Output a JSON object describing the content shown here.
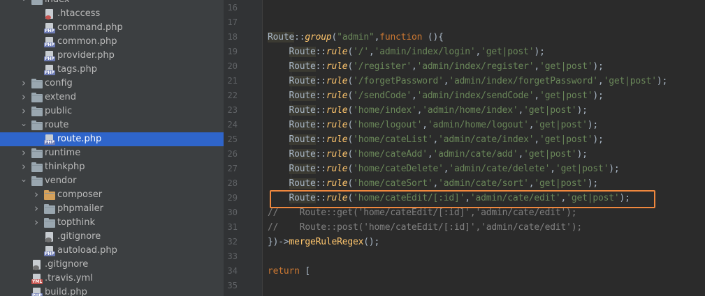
{
  "project_tree": {
    "rows": [
      {
        "label": "index",
        "kind": "folder",
        "depth": 2,
        "expanded": true,
        "badge": ""
      },
      {
        "label": ".htaccess",
        "kind": "file",
        "depth": 3,
        "badge": "ht",
        "icon": "htaccess-file-icon"
      },
      {
        "label": "command.php",
        "kind": "file",
        "depth": 3,
        "badge": "PHP",
        "icon": "php-file-icon"
      },
      {
        "label": "common.php",
        "kind": "file",
        "depth": 3,
        "badge": "PHP",
        "icon": "php-file-icon"
      },
      {
        "label": "provider.php",
        "kind": "file",
        "depth": 3,
        "badge": "PHP",
        "icon": "php-file-icon"
      },
      {
        "label": "tags.php",
        "kind": "file",
        "depth": 3,
        "badge": "PHP",
        "icon": "php-file-icon"
      },
      {
        "label": "config",
        "kind": "folder",
        "depth": 2,
        "expanded": false
      },
      {
        "label": "extend",
        "kind": "folder",
        "depth": 2,
        "expanded": false
      },
      {
        "label": "public",
        "kind": "folder",
        "depth": 2,
        "expanded": false
      },
      {
        "label": "route",
        "kind": "folder",
        "depth": 2,
        "expanded": true
      },
      {
        "label": "route.php",
        "kind": "file",
        "depth": 3,
        "badge": "PHP",
        "icon": "php-file-icon",
        "selected": true
      },
      {
        "label": "runtime",
        "kind": "folder",
        "depth": 2,
        "expanded": false
      },
      {
        "label": "thinkphp",
        "kind": "folder",
        "depth": 2,
        "expanded": false
      },
      {
        "label": "vendor",
        "kind": "folder",
        "depth": 2,
        "expanded": true
      },
      {
        "label": "composer",
        "kind": "folder",
        "depth": 3,
        "expanded": false,
        "highlight": true
      },
      {
        "label": "phpmailer",
        "kind": "folder",
        "depth": 3,
        "expanded": false
      },
      {
        "label": "topthink",
        "kind": "folder",
        "depth": 3,
        "expanded": false
      },
      {
        "label": ".gitignore",
        "kind": "file",
        "depth": 3,
        "badge": "git",
        "icon": "gitignore-file-icon"
      },
      {
        "label": "autoload.php",
        "kind": "file",
        "depth": 3,
        "badge": "PHP",
        "icon": "php-file-icon"
      },
      {
        "label": ".gitignore",
        "kind": "file",
        "depth": 2,
        "badge": "git",
        "icon": "gitignore-file-icon"
      },
      {
        "label": ".travis.yml",
        "kind": "file",
        "depth": 2,
        "badge": "YML",
        "icon": "yml-file-icon"
      },
      {
        "label": "build.php",
        "kind": "file",
        "depth": 2,
        "badge": "PHP",
        "icon": "php-file-icon"
      }
    ]
  },
  "editor": {
    "highlighted_line": 29,
    "lines": [
      {
        "num": "16",
        "tokens": []
      },
      {
        "num": "17",
        "tokens": []
      },
      {
        "num": "18",
        "tokens": [
          [
            "cls-hl",
            "Route"
          ],
          [
            "op",
            "::"
          ],
          [
            "fn",
            "group"
          ],
          [
            "pn",
            "("
          ],
          [
            "str",
            "\"admin\""
          ],
          [
            "pn",
            ","
          ],
          [
            "kw",
            "function"
          ],
          [
            "pn",
            " (){"
          ]
        ]
      },
      {
        "num": "19",
        "tokens": [
          [
            "pn",
            "    "
          ],
          [
            "cls-hl",
            "Route"
          ],
          [
            "op",
            "::"
          ],
          [
            "fn",
            "rule"
          ],
          [
            "pn",
            "("
          ],
          [
            "str",
            "'/'"
          ],
          [
            "pn",
            ","
          ],
          [
            "str",
            "'admin/index/login'"
          ],
          [
            "pn",
            ","
          ],
          [
            "str",
            "'get|post'"
          ],
          [
            "pn",
            ");"
          ]
        ]
      },
      {
        "num": "20",
        "tokens": [
          [
            "pn",
            "    "
          ],
          [
            "cls-hl",
            "Route"
          ],
          [
            "op",
            "::"
          ],
          [
            "fn",
            "rule"
          ],
          [
            "pn",
            "("
          ],
          [
            "str",
            "'/register'"
          ],
          [
            "pn",
            ","
          ],
          [
            "str",
            "'admin/index/register'"
          ],
          [
            "pn",
            ","
          ],
          [
            "str",
            "'get|post'"
          ],
          [
            "pn",
            ");"
          ]
        ]
      },
      {
        "num": "21",
        "tokens": [
          [
            "pn",
            "    "
          ],
          [
            "cls-hl",
            "Route"
          ],
          [
            "op",
            "::"
          ],
          [
            "fn",
            "rule"
          ],
          [
            "pn",
            "("
          ],
          [
            "str",
            "'/forgetPassword'"
          ],
          [
            "pn",
            ","
          ],
          [
            "str",
            "'admin/index/forgetPassword'"
          ],
          [
            "pn",
            ","
          ],
          [
            "str",
            "'get|post'"
          ],
          [
            "pn",
            ");"
          ]
        ]
      },
      {
        "num": "22",
        "tokens": [
          [
            "pn",
            "    "
          ],
          [
            "cls-hl",
            "Route"
          ],
          [
            "op",
            "::"
          ],
          [
            "fn",
            "rule"
          ],
          [
            "pn",
            "("
          ],
          [
            "str",
            "'/sendCode'"
          ],
          [
            "pn",
            ","
          ],
          [
            "str",
            "'admin/index/sendCode'"
          ],
          [
            "pn",
            ","
          ],
          [
            "str",
            "'get|post'"
          ],
          [
            "pn",
            ");"
          ]
        ]
      },
      {
        "num": "23",
        "tokens": [
          [
            "pn",
            "    "
          ],
          [
            "cls-hl",
            "Route"
          ],
          [
            "op",
            "::"
          ],
          [
            "fn",
            "rule"
          ],
          [
            "pn",
            "("
          ],
          [
            "str",
            "'home/index'"
          ],
          [
            "pn",
            ","
          ],
          [
            "str",
            "'admin/home/index'"
          ],
          [
            "pn",
            ","
          ],
          [
            "str",
            "'get|post'"
          ],
          [
            "pn",
            ");"
          ]
        ]
      },
      {
        "num": "24",
        "tokens": [
          [
            "pn",
            "    "
          ],
          [
            "cls-hl",
            "Route"
          ],
          [
            "op",
            "::"
          ],
          [
            "fn",
            "rule"
          ],
          [
            "pn",
            "("
          ],
          [
            "str",
            "'home/logout'"
          ],
          [
            "pn",
            ","
          ],
          [
            "str",
            "'admin/home/logout'"
          ],
          [
            "pn",
            ","
          ],
          [
            "str",
            "'get|post'"
          ],
          [
            "pn",
            ");"
          ]
        ]
      },
      {
        "num": "25",
        "tokens": [
          [
            "pn",
            "    "
          ],
          [
            "cls-hl",
            "Route"
          ],
          [
            "op",
            "::"
          ],
          [
            "fn",
            "rule"
          ],
          [
            "pn",
            "("
          ],
          [
            "str",
            "'home/cateList'"
          ],
          [
            "pn",
            ","
          ],
          [
            "str",
            "'admin/cate/index'"
          ],
          [
            "pn",
            ","
          ],
          [
            "str",
            "'get|post'"
          ],
          [
            "pn",
            ");"
          ]
        ]
      },
      {
        "num": "26",
        "tokens": [
          [
            "pn",
            "    "
          ],
          [
            "cls-hl",
            "Route"
          ],
          [
            "op",
            "::"
          ],
          [
            "fn",
            "rule"
          ],
          [
            "pn",
            "("
          ],
          [
            "str",
            "'home/cateAdd'"
          ],
          [
            "pn",
            ","
          ],
          [
            "str",
            "'admin/cate/add'"
          ],
          [
            "pn",
            ","
          ],
          [
            "str",
            "'get|post'"
          ],
          [
            "pn",
            ");"
          ]
        ]
      },
      {
        "num": "27",
        "tokens": [
          [
            "pn",
            "    "
          ],
          [
            "cls-hl",
            "Route"
          ],
          [
            "op",
            "::"
          ],
          [
            "fn",
            "rule"
          ],
          [
            "pn",
            "("
          ],
          [
            "str",
            "'home/cateDelete'"
          ],
          [
            "pn",
            ","
          ],
          [
            "str",
            "'admin/cate/delete'"
          ],
          [
            "pn",
            ","
          ],
          [
            "str",
            "'get|post'"
          ],
          [
            "pn",
            ");"
          ]
        ]
      },
      {
        "num": "28",
        "tokens": [
          [
            "pn",
            "    "
          ],
          [
            "cls-hl",
            "Route"
          ],
          [
            "op",
            "::"
          ],
          [
            "fn",
            "rule"
          ],
          [
            "pn",
            "("
          ],
          [
            "str",
            "'home/cateSort'"
          ],
          [
            "pn",
            ","
          ],
          [
            "str",
            "'admin/cate/sort'"
          ],
          [
            "pn",
            ","
          ],
          [
            "str",
            "'get|post'"
          ],
          [
            "pn",
            ");"
          ]
        ]
      },
      {
        "num": "29",
        "tokens": [
          [
            "pn",
            "    "
          ],
          [
            "cls-hl",
            "Route"
          ],
          [
            "op",
            "::"
          ],
          [
            "fn",
            "rule"
          ],
          [
            "pn",
            "("
          ],
          [
            "str",
            "'home/cateEdit/[:id]'"
          ],
          [
            "pn",
            ","
          ],
          [
            "str",
            "'admin/cate/edit'"
          ],
          [
            "pn",
            ","
          ],
          [
            "str",
            "'get|post'"
          ],
          [
            "pn",
            ");"
          ]
        ]
      },
      {
        "num": "30",
        "tokens": [
          [
            "cm",
            "//    Route::get('home/cateEdit/[:id]','admin/cate/edit');"
          ]
        ]
      },
      {
        "num": "31",
        "tokens": [
          [
            "cm",
            "//    Route::post('home/cateEdit/[:id]','admin/cate/edit');"
          ]
        ]
      },
      {
        "num": "32",
        "tokens": [
          [
            "pn",
            "})->"
          ],
          [
            "fn2",
            "mergeRuleRegex"
          ],
          [
            "pn",
            "();"
          ]
        ]
      },
      {
        "num": "33",
        "tokens": []
      },
      {
        "num": "34",
        "tokens": [
          [
            "kw",
            "return"
          ],
          [
            "pn",
            " ["
          ]
        ]
      },
      {
        "num": "35",
        "tokens": []
      }
    ]
  },
  "colors": {
    "accent_box": "#f0883e",
    "selection": "#2f65ca"
  }
}
